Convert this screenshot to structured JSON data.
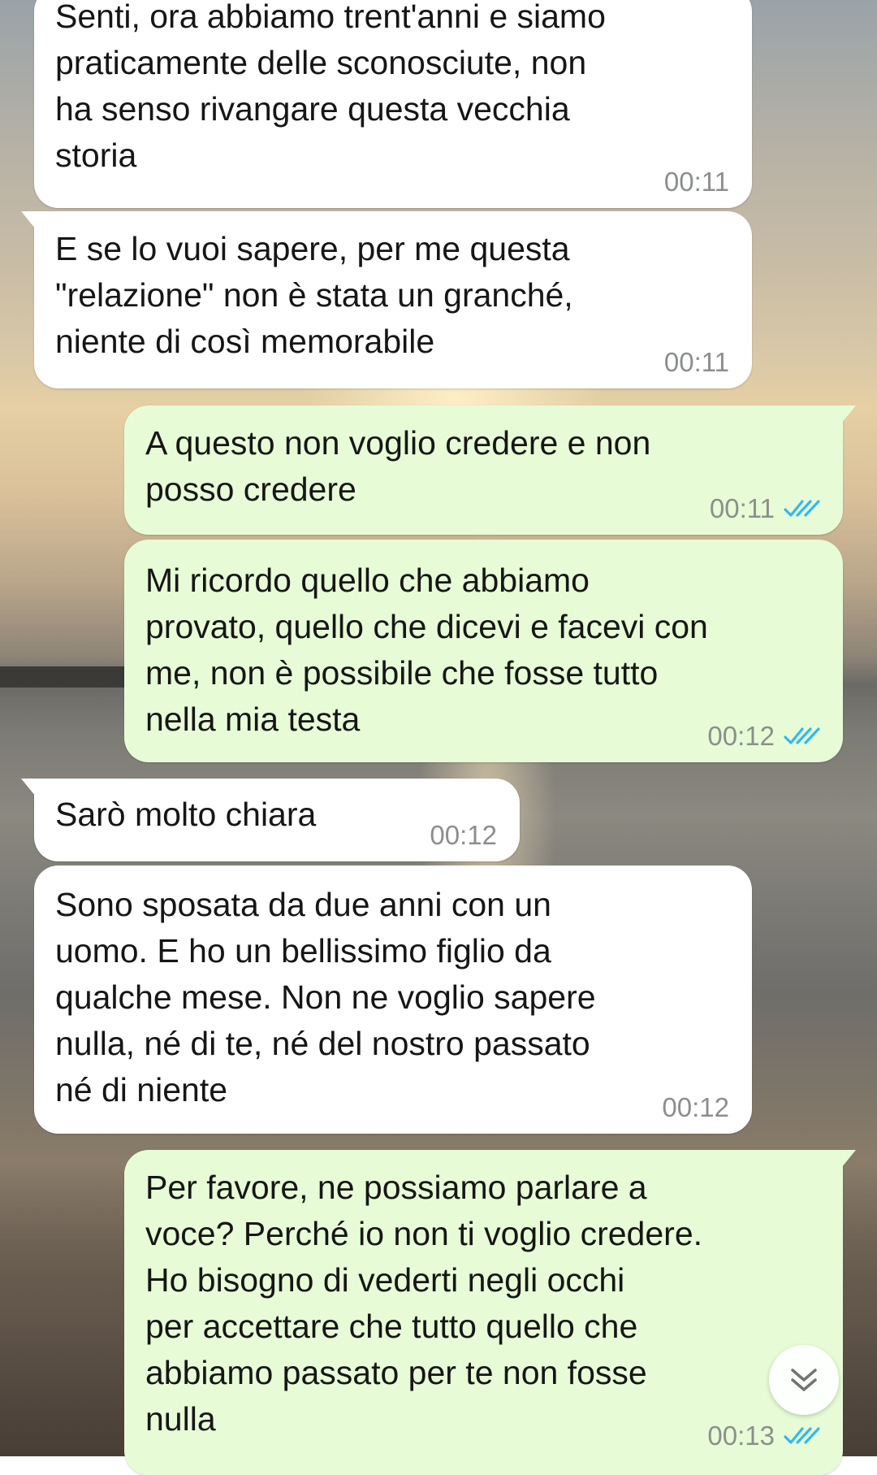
{
  "messages": [
    {
      "id": "m1",
      "direction": "incoming",
      "lines": [
        "Senti, ora abbiamo trent'anni e siamo",
        "praticamente delle sconosciute, non",
        "ha senso rivangare questa vecchia",
        "storia"
      ],
      "time": "00:11"
    },
    {
      "id": "m2",
      "direction": "incoming",
      "lines": [
        "E se lo vuoi sapere, per me questa",
        "\"relazione\" non è stata un granché,",
        "niente di così memorabile"
      ],
      "time": "00:11"
    },
    {
      "id": "m3",
      "direction": "outgoing",
      "lines": [
        "A questo non voglio credere e non",
        "posso credere"
      ],
      "time": "00:11",
      "status_icon": "double-check-read-icon"
    },
    {
      "id": "m4",
      "direction": "outgoing",
      "lines": [
        "Mi ricordo quello che abbiamo",
        "provato, quello che dicevi e facevi con",
        "me, non è possibile che fosse tutto",
        "nella mia testa"
      ],
      "time": "00:12",
      "status_icon": "double-check-read-icon"
    },
    {
      "id": "m5",
      "direction": "incoming",
      "lines": [
        "Sarò molto chiara"
      ],
      "time": "00:12"
    },
    {
      "id": "m6",
      "direction": "incoming",
      "lines": [
        "Sono sposata da due anni con un",
        "uomo. E ho un bellissimo figlio da",
        "qualche mese. Non ne voglio sapere",
        "nulla, né di te, né del nostro passato",
        "né di niente"
      ],
      "time": "00:12"
    },
    {
      "id": "m7",
      "direction": "outgoing",
      "lines": [
        "Per favore, ne possiamo parlare a",
        "voce? Perché io non ti voglio credere.",
        "Ho bisogno di vederti negli occhi",
        "per accettare che tutto quello che",
        "abbiamo passato per te non fosse",
        "nulla"
      ],
      "time": "00:13",
      "status_icon": "double-check-read-icon"
    }
  ],
  "scroll_button": {
    "icon": "chevron-double-down-icon"
  },
  "colors": {
    "incoming_bubble": "#ffffff",
    "outgoing_bubble": "#e7fcd6",
    "read_ticks": "#34b7f1",
    "timestamp": "#8b8f8c"
  }
}
